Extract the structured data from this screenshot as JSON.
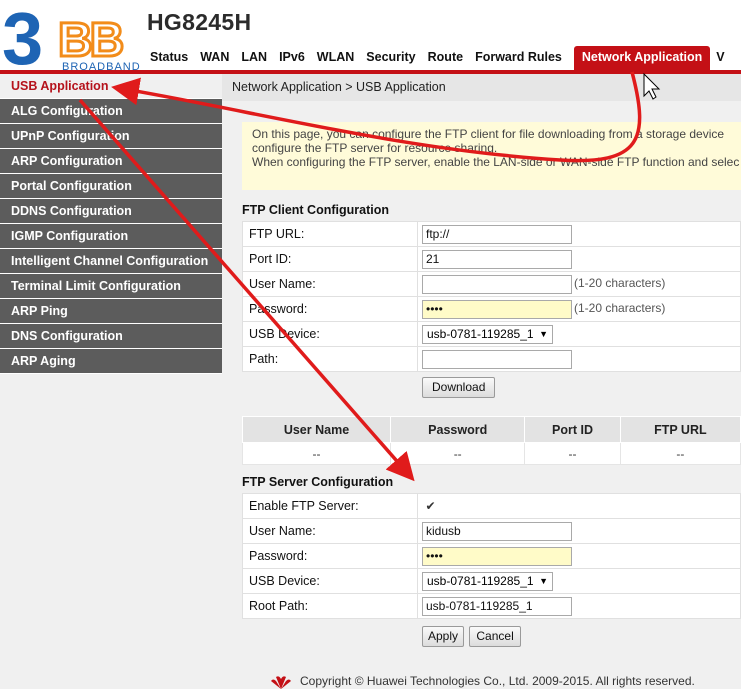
{
  "brand": {
    "logo_number": "3",
    "logo_letters": "BB",
    "logo_subtext": "BROADBAND",
    "model": "HG8245H"
  },
  "nav": {
    "items": [
      "Status",
      "WAN",
      "LAN",
      "IPv6",
      "WLAN",
      "Security",
      "Route",
      "Forward Rules"
    ],
    "active": "Network Application",
    "partial": "V"
  },
  "sidebar": {
    "active": "USB Application",
    "items": [
      "ALG Configuration",
      "UPnP Configuration",
      "ARP Configuration",
      "Portal Configuration",
      "DDNS Configuration",
      "IGMP Configuration",
      "Intelligent Channel Configuration",
      "Terminal Limit Configuration",
      "ARP Ping",
      "DNS Configuration",
      "ARP Aging"
    ]
  },
  "breadcrumb": "Network Application > USB Application",
  "info": {
    "line1": "On this page, you can configure the FTP client for file downloading from a storage device",
    "line2": "configure the FTP server for resource sharing.",
    "line3": "When configuring the FTP server, enable the LAN-side or WAN-side FTP function and selec"
  },
  "ftp_client": {
    "title": "FTP Client Configuration",
    "url_label": "FTP URL:",
    "url_value": "ftp://",
    "port_label": "Port ID:",
    "port_value": "21",
    "user_label": "User Name:",
    "user_value": "",
    "user_hint": "(1-20 characters)",
    "pass_label": "Password:",
    "pass_value": "••••",
    "pass_hint": "(1-20 characters)",
    "device_label": "USB Device:",
    "device_value": "usb-0781-119285_1",
    "path_label": "Path:",
    "path_value": "",
    "download_button": "Download"
  },
  "ftp_list": {
    "headers": [
      "User Name",
      "Password",
      "Port ID",
      "FTP URL"
    ],
    "row": [
      "--",
      "--",
      "--",
      "--"
    ]
  },
  "ftp_server": {
    "title": "FTP Server Configuration",
    "enable_label": "Enable FTP Server:",
    "enable_checked": "✔",
    "user_label": "User Name:",
    "user_value": "kidusb",
    "pass_label": "Password:",
    "pass_value": "••••",
    "device_label": "USB Device:",
    "device_value": "usb-0781-119285_1",
    "root_label": "Root Path:",
    "root_value": "usb-0781-119285_1",
    "apply_button": "Apply",
    "cancel_button": "Cancel"
  },
  "footer": {
    "text": "Copyright © Huawei Technologies Co., Ltd. 2009-2015. All rights reserved."
  },
  "colors": {
    "accent_red": "#c41016",
    "sidebar_gray": "#5c5c5c",
    "logo_blue": "#1e64b4",
    "logo_orange": "#f28c1a",
    "info_bg": "#fffbd9"
  }
}
